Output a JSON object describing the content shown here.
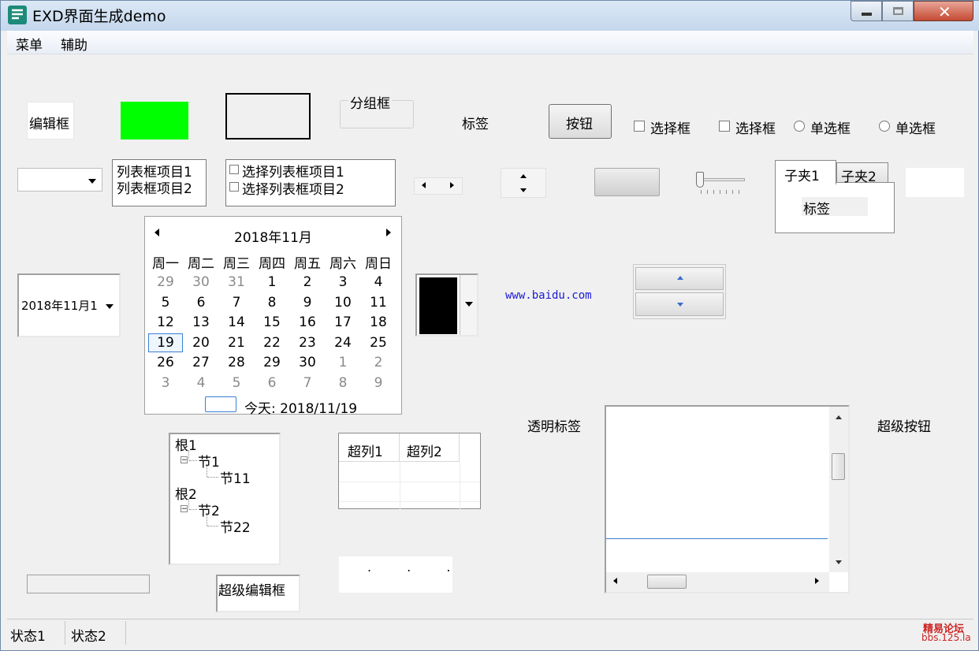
{
  "window": {
    "title": "EXD界面生成demo"
  },
  "menu": {
    "items": [
      "菜单",
      "辅助"
    ]
  },
  "controls": {
    "edit_label": "编辑框",
    "groupbox_label": "分组框",
    "static_label": "标签",
    "button_label": "按钮",
    "checkbox1": "选择框",
    "checkbox2": "选择框",
    "radio1": "单选框",
    "radio2": "单选框",
    "listbox_items": [
      "列表框项目1",
      "列表框项目2"
    ],
    "checklist_items": [
      "选择列表框项目1",
      "选择列表框项目2"
    ],
    "tabs": [
      "子夹1",
      "子夹2"
    ],
    "tab_content_label": "标签",
    "datepicker_value": "2018年11月1",
    "link_text": "www.baidu.com",
    "transparent_label": "透明标签",
    "super_button": "超级按钮",
    "super_edit": "超级编辑框",
    "super_list_columns": [
      "超列1",
      "超列2"
    ],
    "tree": [
      {
        "label": "根1",
        "children": [
          {
            "label": "节1",
            "children": [
              {
                "label": "节11"
              }
            ]
          }
        ]
      },
      {
        "label": "根2",
        "children": [
          {
            "label": "节2",
            "children": [
              {
                "label": "节22"
              }
            ]
          }
        ]
      }
    ],
    "ip_dots": ". . ."
  },
  "calendar": {
    "title": "2018年11月",
    "weekdays": [
      "周一",
      "周二",
      "周三",
      "周四",
      "周五",
      "周六",
      "周日"
    ],
    "rows": [
      [
        "29",
        "30",
        "31",
        "1",
        "2",
        "3",
        "4"
      ],
      [
        "5",
        "6",
        "7",
        "8",
        "9",
        "10",
        "11"
      ],
      [
        "12",
        "13",
        "14",
        "15",
        "16",
        "17",
        "18"
      ],
      [
        "19",
        "20",
        "21",
        "22",
        "23",
        "24",
        "25"
      ],
      [
        "26",
        "27",
        "28",
        "29",
        "30",
        "1",
        "2"
      ],
      [
        "3",
        "4",
        "5",
        "6",
        "7",
        "8",
        "9"
      ]
    ],
    "today_text": "今天: 2018/11/19",
    "selected_day": "19"
  },
  "statusbar": {
    "items": [
      "状态1",
      "状态2"
    ]
  },
  "watermark": {
    "line1": "精易论坛",
    "line2": "bbs.125.la"
  },
  "colors": {
    "green_box": "#00ff00",
    "color_picker": "#000000",
    "link": "#1a1ad6",
    "watermark": "#cc2222"
  }
}
